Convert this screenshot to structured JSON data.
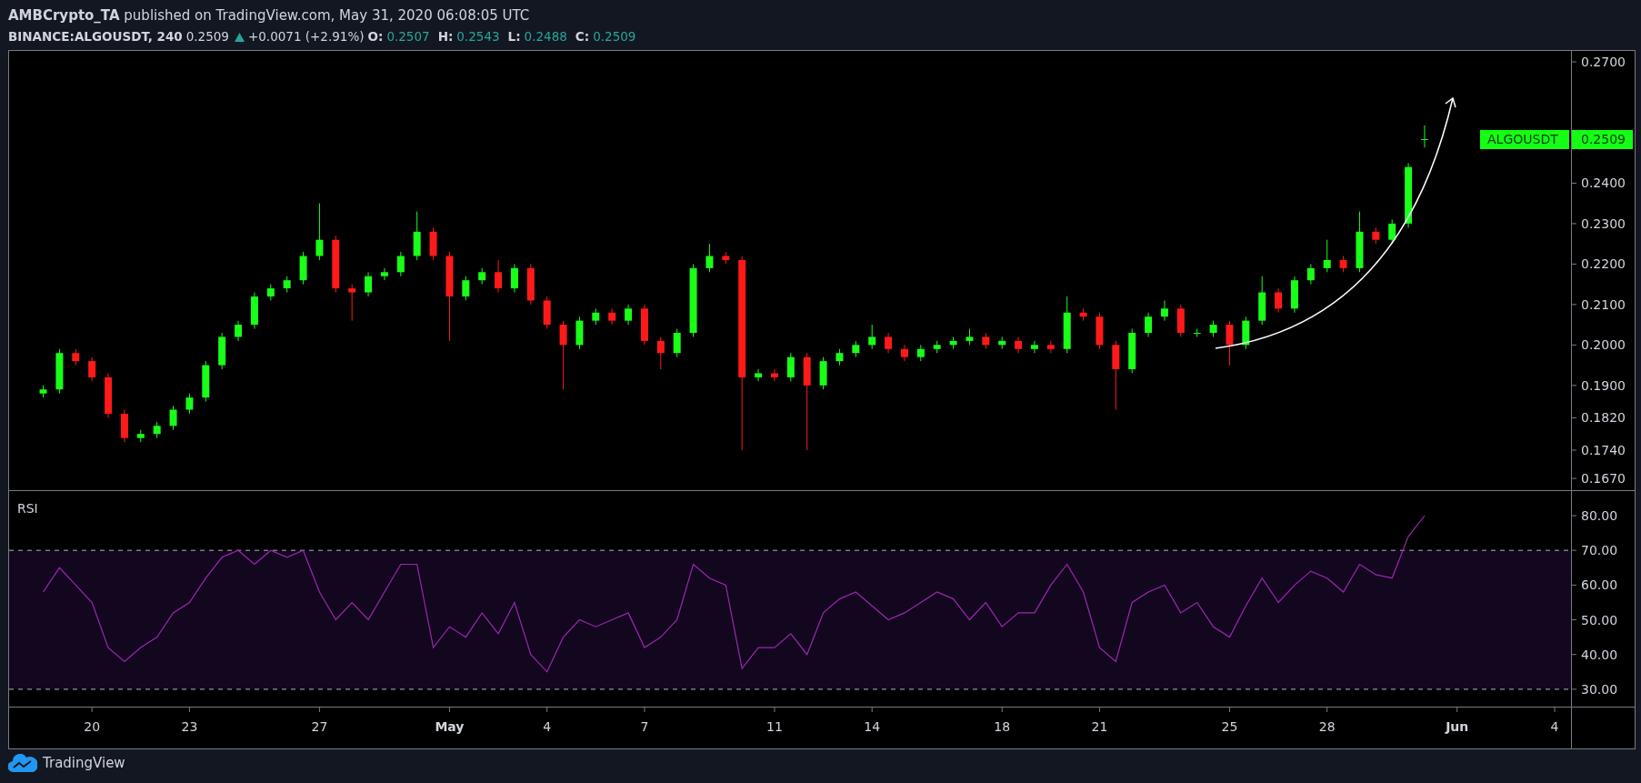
{
  "header": {
    "author": "AMBCrypto_TA",
    "published": "published on TradingView.com, May 31, 2020 06:08:05 UTC"
  },
  "symbol_bar": {
    "symbol": "BINANCE:ALGOUSDT, 240",
    "last": "0.2509",
    "change": "+0.0071 (+2.91%)",
    "ohlc": [
      {
        "label": "O:",
        "value": "0.2507"
      },
      {
        "label": "H:",
        "value": "0.2543"
      },
      {
        "label": "L:",
        "value": "0.2488"
      },
      {
        "label": "C:",
        "value": "0.2509"
      }
    ]
  },
  "price_pane": {
    "label": "ALGOUSDT",
    "price": "0.2509",
    "chart_data": {
      "type": "candlestick",
      "x": [
        "2020-04-18T12:00",
        "2020-04-19T00:00",
        "2020-04-19T12:00",
        "2020-04-20T00:00",
        "2020-04-20T12:00",
        "2020-04-21T00:00",
        "2020-04-21T12:00",
        "2020-04-22T00:00",
        "2020-04-22T12:00",
        "2020-04-23T00:00",
        "2020-04-23T12:00",
        "2020-04-24T00:00",
        "2020-04-24T12:00",
        "2020-04-25T00:00",
        "2020-04-25T12:00",
        "2020-04-26T00:00",
        "2020-04-26T12:00",
        "2020-04-27T00:00",
        "2020-04-27T12:00",
        "2020-04-28T00:00",
        "2020-04-28T12:00",
        "2020-04-29T00:00",
        "2020-04-29T12:00",
        "2020-04-30T00:00",
        "2020-04-30T12:00",
        "2020-05-01T00:00",
        "2020-05-01T12:00",
        "2020-05-02T00:00",
        "2020-05-02T12:00",
        "2020-05-03T00:00",
        "2020-05-03T12:00",
        "2020-05-04T00:00",
        "2020-05-04T12:00",
        "2020-05-05T00:00",
        "2020-05-05T12:00",
        "2020-05-06T00:00",
        "2020-05-06T12:00",
        "2020-05-07T00:00",
        "2020-05-07T12:00",
        "2020-05-08T00:00",
        "2020-05-08T12:00",
        "2020-05-09T00:00",
        "2020-05-09T12:00",
        "2020-05-10T00:00",
        "2020-05-10T12:00",
        "2020-05-11T00:00",
        "2020-05-11T12:00",
        "2020-05-12T00:00",
        "2020-05-12T12:00",
        "2020-05-13T00:00",
        "2020-05-13T12:00",
        "2020-05-14T00:00",
        "2020-05-14T12:00",
        "2020-05-15T00:00",
        "2020-05-15T12:00",
        "2020-05-16T00:00",
        "2020-05-16T12:00",
        "2020-05-17T00:00",
        "2020-05-17T12:00",
        "2020-05-18T00:00",
        "2020-05-18T12:00",
        "2020-05-19T00:00",
        "2020-05-19T12:00",
        "2020-05-20T00:00",
        "2020-05-20T12:00",
        "2020-05-21T00:00",
        "2020-05-21T12:00",
        "2020-05-22T00:00",
        "2020-05-22T12:00",
        "2020-05-23T00:00",
        "2020-05-23T12:00",
        "2020-05-24T00:00",
        "2020-05-24T12:00",
        "2020-05-25T00:00",
        "2020-05-25T12:00",
        "2020-05-26T00:00",
        "2020-05-26T12:00",
        "2020-05-27T00:00",
        "2020-05-27T12:00",
        "2020-05-28T00:00",
        "2020-05-28T12:00",
        "2020-05-29T00:00",
        "2020-05-29T12:00",
        "2020-05-30T00:00",
        "2020-05-30T12:00",
        "2020-05-31T00:00"
      ],
      "ohlc": [
        [
          0.188,
          0.19,
          0.187,
          0.189
        ],
        [
          0.189,
          0.199,
          0.188,
          0.198
        ],
        [
          0.198,
          0.199,
          0.195,
          0.196
        ],
        [
          0.196,
          0.197,
          0.191,
          0.192
        ],
        [
          0.192,
          0.193,
          0.182,
          0.183
        ],
        [
          0.183,
          0.184,
          0.176,
          0.177
        ],
        [
          0.177,
          0.179,
          0.176,
          0.178
        ],
        [
          0.178,
          0.181,
          0.177,
          0.18
        ],
        [
          0.18,
          0.185,
          0.179,
          0.184
        ],
        [
          0.184,
          0.188,
          0.183,
          0.187
        ],
        [
          0.187,
          0.196,
          0.186,
          0.195
        ],
        [
          0.195,
          0.203,
          0.194,
          0.202
        ],
        [
          0.202,
          0.206,
          0.201,
          0.205
        ],
        [
          0.205,
          0.213,
          0.204,
          0.212
        ],
        [
          0.212,
          0.215,
          0.211,
          0.214
        ],
        [
          0.214,
          0.217,
          0.213,
          0.216
        ],
        [
          0.216,
          0.223,
          0.215,
          0.222
        ],
        [
          0.222,
          0.235,
          0.221,
          0.226
        ],
        [
          0.226,
          0.227,
          0.213,
          0.214
        ],
        [
          0.214,
          0.215,
          0.206,
          0.213
        ],
        [
          0.213,
          0.218,
          0.212,
          0.217
        ],
        [
          0.217,
          0.219,
          0.216,
          0.218
        ],
        [
          0.218,
          0.223,
          0.217,
          0.222
        ],
        [
          0.222,
          0.233,
          0.221,
          0.228
        ],
        [
          0.228,
          0.229,
          0.221,
          0.222
        ],
        [
          0.222,
          0.223,
          0.201,
          0.212
        ],
        [
          0.212,
          0.217,
          0.211,
          0.216
        ],
        [
          0.216,
          0.219,
          0.215,
          0.218
        ],
        [
          0.218,
          0.221,
          0.213,
          0.214
        ],
        [
          0.214,
          0.22,
          0.213,
          0.219
        ],
        [
          0.219,
          0.22,
          0.21,
          0.211
        ],
        [
          0.211,
          0.212,
          0.204,
          0.205
        ],
        [
          0.205,
          0.206,
          0.189,
          0.2
        ],
        [
          0.2,
          0.207,
          0.199,
          0.206
        ],
        [
          0.206,
          0.209,
          0.205,
          0.208
        ],
        [
          0.208,
          0.209,
          0.205,
          0.206
        ],
        [
          0.206,
          0.21,
          0.205,
          0.209
        ],
        [
          0.209,
          0.21,
          0.2,
          0.201
        ],
        [
          0.201,
          0.202,
          0.194,
          0.198
        ],
        [
          0.198,
          0.204,
          0.197,
          0.203
        ],
        [
          0.203,
          0.22,
          0.202,
          0.219
        ],
        [
          0.219,
          0.225,
          0.218,
          0.222
        ],
        [
          0.222,
          0.223,
          0.22,
          0.221
        ],
        [
          0.221,
          0.222,
          0.174,
          0.192
        ],
        [
          0.192,
          0.194,
          0.191,
          0.193
        ],
        [
          0.193,
          0.194,
          0.191,
          0.192
        ],
        [
          0.192,
          0.198,
          0.191,
          0.197
        ],
        [
          0.197,
          0.198,
          0.174,
          0.19
        ],
        [
          0.19,
          0.197,
          0.189,
          0.196
        ],
        [
          0.196,
          0.199,
          0.195,
          0.198
        ],
        [
          0.198,
          0.201,
          0.197,
          0.2
        ],
        [
          0.2,
          0.205,
          0.199,
          0.202
        ],
        [
          0.202,
          0.203,
          0.198,
          0.199
        ],
        [
          0.199,
          0.2,
          0.196,
          0.197
        ],
        [
          0.197,
          0.2,
          0.196,
          0.199
        ],
        [
          0.199,
          0.201,
          0.198,
          0.2
        ],
        [
          0.2,
          0.202,
          0.199,
          0.201
        ],
        [
          0.201,
          0.204,
          0.2,
          0.202
        ],
        [
          0.202,
          0.203,
          0.199,
          0.2
        ],
        [
          0.2,
          0.202,
          0.199,
          0.201
        ],
        [
          0.201,
          0.202,
          0.198,
          0.199
        ],
        [
          0.199,
          0.201,
          0.198,
          0.2
        ],
        [
          0.2,
          0.201,
          0.198,
          0.199
        ],
        [
          0.199,
          0.212,
          0.198,
          0.208
        ],
        [
          0.208,
          0.209,
          0.206,
          0.207
        ],
        [
          0.207,
          0.208,
          0.199,
          0.2
        ],
        [
          0.2,
          0.201,
          0.184,
          0.194
        ],
        [
          0.194,
          0.204,
          0.193,
          0.203
        ],
        [
          0.203,
          0.208,
          0.202,
          0.207
        ],
        [
          0.207,
          0.211,
          0.206,
          0.209
        ],
        [
          0.209,
          0.21,
          0.202,
          0.203
        ],
        [
          0.203,
          0.204,
          0.202,
          0.203
        ],
        [
          0.203,
          0.206,
          0.202,
          0.205
        ],
        [
          0.205,
          0.206,
          0.195,
          0.2
        ],
        [
          0.2,
          0.207,
          0.199,
          0.206
        ],
        [
          0.206,
          0.217,
          0.205,
          0.213
        ],
        [
          0.213,
          0.214,
          0.208,
          0.209
        ],
        [
          0.209,
          0.217,
          0.208,
          0.216
        ],
        [
          0.216,
          0.22,
          0.215,
          0.219
        ],
        [
          0.219,
          0.226,
          0.218,
          0.221
        ],
        [
          0.221,
          0.222,
          0.218,
          0.219
        ],
        [
          0.219,
          0.233,
          0.218,
          0.228
        ],
        [
          0.228,
          0.229,
          0.225,
          0.226
        ],
        [
          0.226,
          0.231,
          0.225,
          0.23
        ],
        [
          0.23,
          0.245,
          0.229,
          0.244
        ],
        [
          0.2507,
          0.2543,
          0.2488,
          0.2509
        ]
      ],
      "xlim": [
        "2020-04-17T10:48",
        "2020-06-06T11:46"
      ],
      "ylim": [
        0.1641,
        0.2727
      ],
      "yticks": [
        {
          "value": 0.27,
          "label": "0.2700"
        },
        {
          "value": 0.24,
          "label": "0.2400"
        },
        {
          "value": 0.23,
          "label": "0.2300"
        },
        {
          "value": 0.22,
          "label": "0.2200"
        },
        {
          "value": 0.21,
          "label": "0.2100"
        },
        {
          "value": 0.2,
          "label": "0.2000"
        },
        {
          "value": 0.19,
          "label": "0.1900"
        },
        {
          "value": 0.182,
          "label": "0.1820"
        },
        {
          "value": 0.174,
          "label": "0.1740"
        },
        {
          "value": 0.167,
          "label": "0.1670"
        }
      ]
    }
  },
  "rsi_pane": {
    "chart_data": {
      "type": "line",
      "x": [
        "2020-04-18T12:00",
        "2020-04-19T00:00",
        "2020-04-19T12:00",
        "2020-04-20T00:00",
        "2020-04-20T12:00",
        "2020-04-21T00:00",
        "2020-04-21T12:00",
        "2020-04-22T00:00",
        "2020-04-22T12:00",
        "2020-04-23T00:00",
        "2020-04-23T12:00",
        "2020-04-24T00:00",
        "2020-04-24T12:00",
        "2020-04-25T00:00",
        "2020-04-25T12:00",
        "2020-04-26T00:00",
        "2020-04-26T12:00",
        "2020-04-27T00:00",
        "2020-04-27T12:00",
        "2020-04-28T00:00",
        "2020-04-28T12:00",
        "2020-04-29T00:00",
        "2020-04-29T12:00",
        "2020-04-30T00:00",
        "2020-04-30T12:00",
        "2020-05-01T00:00",
        "2020-05-01T12:00",
        "2020-05-02T00:00",
        "2020-05-02T12:00",
        "2020-05-03T00:00",
        "2020-05-03T12:00",
        "2020-05-04T00:00",
        "2020-05-04T12:00",
        "2020-05-05T00:00",
        "2020-05-05T12:00",
        "2020-05-06T00:00",
        "2020-05-06T12:00",
        "2020-05-07T00:00",
        "2020-05-07T12:00",
        "2020-05-08T00:00",
        "2020-05-08T12:00",
        "2020-05-09T00:00",
        "2020-05-09T12:00",
        "2020-05-10T00:00",
        "2020-05-10T12:00",
        "2020-05-11T00:00",
        "2020-05-11T12:00",
        "2020-05-12T00:00",
        "2020-05-12T12:00",
        "2020-05-13T00:00",
        "2020-05-13T12:00",
        "2020-05-14T00:00",
        "2020-05-14T12:00",
        "2020-05-15T00:00",
        "2020-05-15T12:00",
        "2020-05-16T00:00",
        "2020-05-16T12:00",
        "2020-05-17T00:00",
        "2020-05-17T12:00",
        "2020-05-18T00:00",
        "2020-05-18T12:00",
        "2020-05-19T00:00",
        "2020-05-19T12:00",
        "2020-05-20T00:00",
        "2020-05-20T12:00",
        "2020-05-21T00:00",
        "2020-05-21T12:00",
        "2020-05-22T00:00",
        "2020-05-22T12:00",
        "2020-05-23T00:00",
        "2020-05-23T12:00",
        "2020-05-24T00:00",
        "2020-05-24T12:00",
        "2020-05-25T00:00",
        "2020-05-25T12:00",
        "2020-05-26T00:00",
        "2020-05-26T12:00",
        "2020-05-27T00:00",
        "2020-05-27T12:00",
        "2020-05-28T00:00",
        "2020-05-28T12:00",
        "2020-05-29T00:00",
        "2020-05-29T12:00",
        "2020-05-30T00:00",
        "2020-05-30T12:00",
        "2020-05-31T00:00"
      ],
      "series": [
        {
          "name": "RSI",
          "color": "#9c27b0",
          "values": [
            58,
            65,
            60,
            55,
            42,
            38,
            42,
            45,
            52,
            55,
            62,
            68,
            70,
            66,
            70,
            68,
            70,
            58,
            50,
            55,
            50,
            58,
            66,
            66,
            42,
            48,
            45,
            52,
            46,
            55,
            40,
            35,
            45,
            50,
            48,
            50,
            52,
            42,
            45,
            50,
            66,
            62,
            60,
            36,
            42,
            42,
            46,
            40,
            52,
            56,
            58,
            54,
            50,
            52,
            55,
            58,
            56,
            50,
            55,
            48,
            52,
            52,
            60,
            66,
            58,
            42,
            38,
            55,
            58,
            60,
            52,
            55,
            48,
            45,
            54,
            62,
            55,
            60,
            64,
            62,
            58,
            66,
            63,
            62,
            74,
            80
          ]
        }
      ],
      "xlim": [
        "2020-04-17T10:48",
        "2020-06-06T11:46"
      ],
      "ylim": [
        25,
        87.07
      ],
      "xticks": [
        {
          "value": "2020-04-20",
          "label": "20"
        },
        {
          "value": "2020-04-23",
          "label": "23"
        },
        {
          "value": "2020-04-27",
          "label": "27"
        },
        {
          "value": "2020-05-01",
          "label": "May"
        },
        {
          "value": "2020-05-04",
          "label": "4"
        },
        {
          "value": "2020-05-07",
          "label": "7"
        },
        {
          "value": "2020-05-11",
          "label": "11"
        },
        {
          "value": "2020-05-14",
          "label": "14"
        },
        {
          "value": "2020-05-18",
          "label": "18"
        },
        {
          "value": "2020-05-21",
          "label": "21"
        },
        {
          "value": "2020-05-25",
          "label": "25"
        },
        {
          "value": "2020-05-28",
          "label": "28"
        },
        {
          "value": "2020-06-01",
          "label": "Jun"
        },
        {
          "value": "2020-06-04",
          "label": "4"
        }
      ],
      "yticks": [
        {
          "value": 80,
          "label": "80.00"
        },
        {
          "value": 70,
          "label": "70.00"
        },
        {
          "value": 60,
          "label": "60.00"
        },
        {
          "value": 50,
          "label": "50.00"
        },
        {
          "value": 40,
          "label": "40.00"
        },
        {
          "value": 30,
          "label": "30.00"
        }
      ],
      "bands": [
        {
          "from": 30,
          "to": 70,
          "axis": "y"
        }
      ]
    }
  },
  "footer": {
    "brand": "TradingView"
  }
}
